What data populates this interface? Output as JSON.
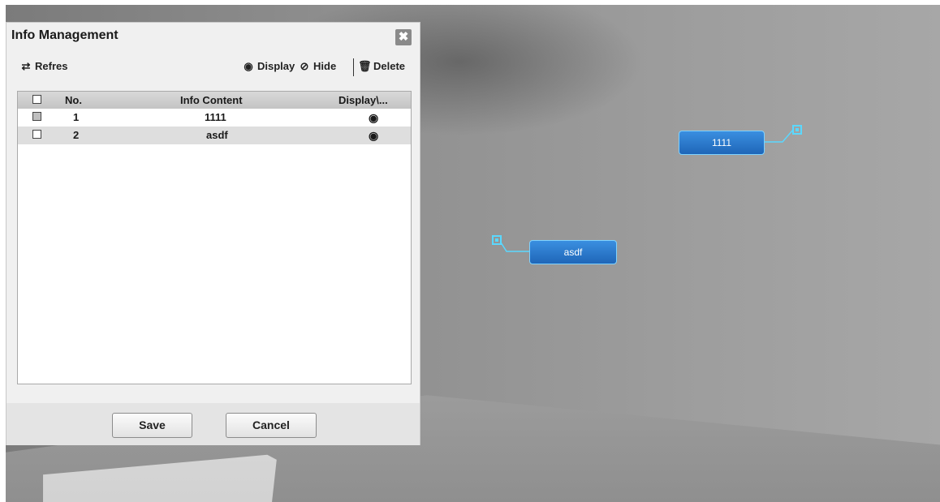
{
  "dialog": {
    "title": "Info Management",
    "close_glyph": "✖",
    "toolbar": {
      "refresh_label": "Refres",
      "display_label": "Display",
      "hide_label": "Hide",
      "delete_label": "Delete",
      "icons": {
        "refresh": "refresh-icon",
        "display": "eye-icon",
        "hide": "eye-slash-icon",
        "delete": "trash-icon"
      }
    },
    "table": {
      "columns": [
        "No.",
        "Info Content",
        "Display\\..."
      ],
      "rows": [
        {
          "no": "1",
          "content": "1111",
          "display_icon": "eye-icon"
        },
        {
          "no": "2",
          "content": "asdf",
          "display_icon": "eye-icon"
        }
      ]
    },
    "buttons": {
      "save_label": "Save",
      "cancel_label": "Cancel"
    }
  },
  "overlays": [
    {
      "text": "1111"
    },
    {
      "text": "asdf"
    }
  ],
  "colors": {
    "osd_fill": "#2a78cc",
    "osd_border": "#7fd2ff",
    "osd_connector": "#5ad8ff"
  }
}
